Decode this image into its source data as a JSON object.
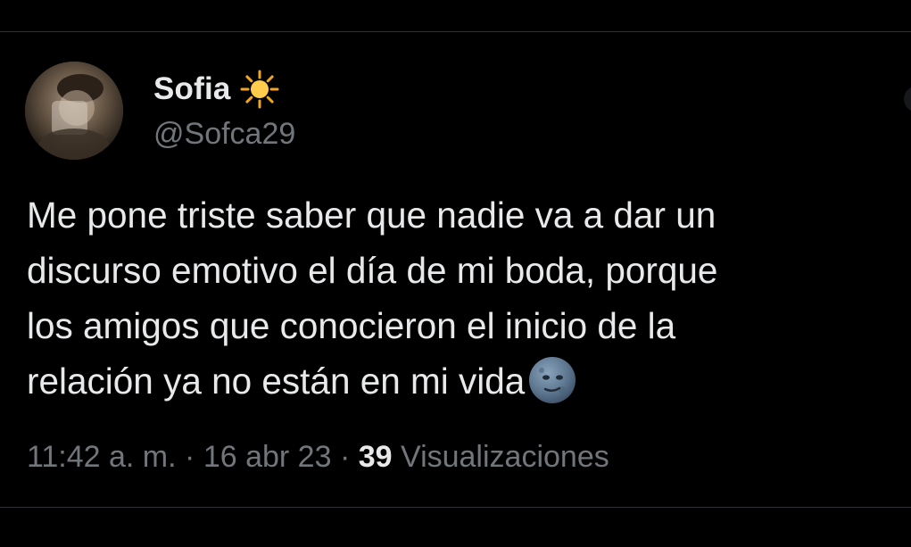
{
  "tweet": {
    "author": {
      "name": "Sofia",
      "name_emoji_icon": "sun-icon",
      "handle": "@Sofca29"
    },
    "text_lines": [
      "Me pone triste saber que nadie va a dar un",
      "discurso emotivo el día de mi boda, porque",
      "los amigos que conocieron el inicio de la",
      "relación ya no están en mi vida"
    ],
    "text_emoji_icon": "new-moon-face-icon",
    "meta": {
      "time": "11:42 a. m.",
      "separator": "·",
      "date": "16 abr 23",
      "views_count": "39",
      "views_label": "Visualizaciones"
    }
  },
  "colors": {
    "background": "#000000",
    "primary_text": "#e7e9ea",
    "secondary_text": "#71767b",
    "divider": "#2f3336"
  }
}
